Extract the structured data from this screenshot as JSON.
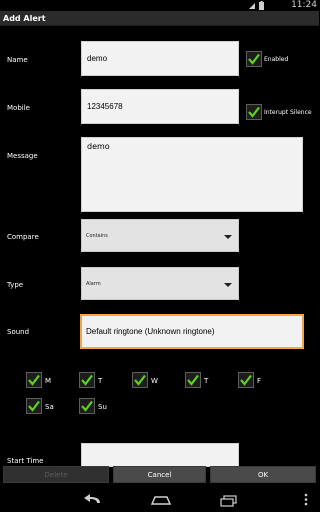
{
  "status": {
    "icons": "▮▮ ▮",
    "time": "11:24"
  },
  "title": "Add Alert",
  "form": {
    "name": {
      "label": "Name",
      "value": "demo",
      "check_label": "Enabled",
      "checked": true
    },
    "mobile": {
      "label": "Mobile",
      "value": "12345678",
      "check_label": "Interupt Silence",
      "checked": true
    },
    "message": {
      "label": "Message",
      "value": "demo"
    },
    "compare": {
      "label": "Compare",
      "value": "Contains"
    },
    "type": {
      "label": "Type",
      "value": "Alarm"
    },
    "sound": {
      "label": "Sound",
      "value": "Default ringtone (Unknown ringtone)"
    },
    "days": [
      {
        "label": "M",
        "checked": true
      },
      {
        "label": "T",
        "checked": true
      },
      {
        "label": "W",
        "checked": true
      },
      {
        "label": "T",
        "checked": true
      },
      {
        "label": "F",
        "checked": true
      },
      {
        "label": "Sa",
        "checked": true
      },
      {
        "label": "Su",
        "checked": true
      }
    ],
    "start_time": {
      "label": "Start Time",
      "value": ""
    }
  },
  "buttons": {
    "delete": "Delete",
    "cancel": "Cancel",
    "ok": "OK"
  },
  "nav": {
    "back_icon": "back-icon",
    "home_icon": "home-icon",
    "recents_icon": "recents-icon",
    "menu_icon": "overflow-menu-icon"
  },
  "colors": {
    "accent_check": "#5fd11e",
    "focus_border": "#f5a545",
    "background": "#000000"
  }
}
